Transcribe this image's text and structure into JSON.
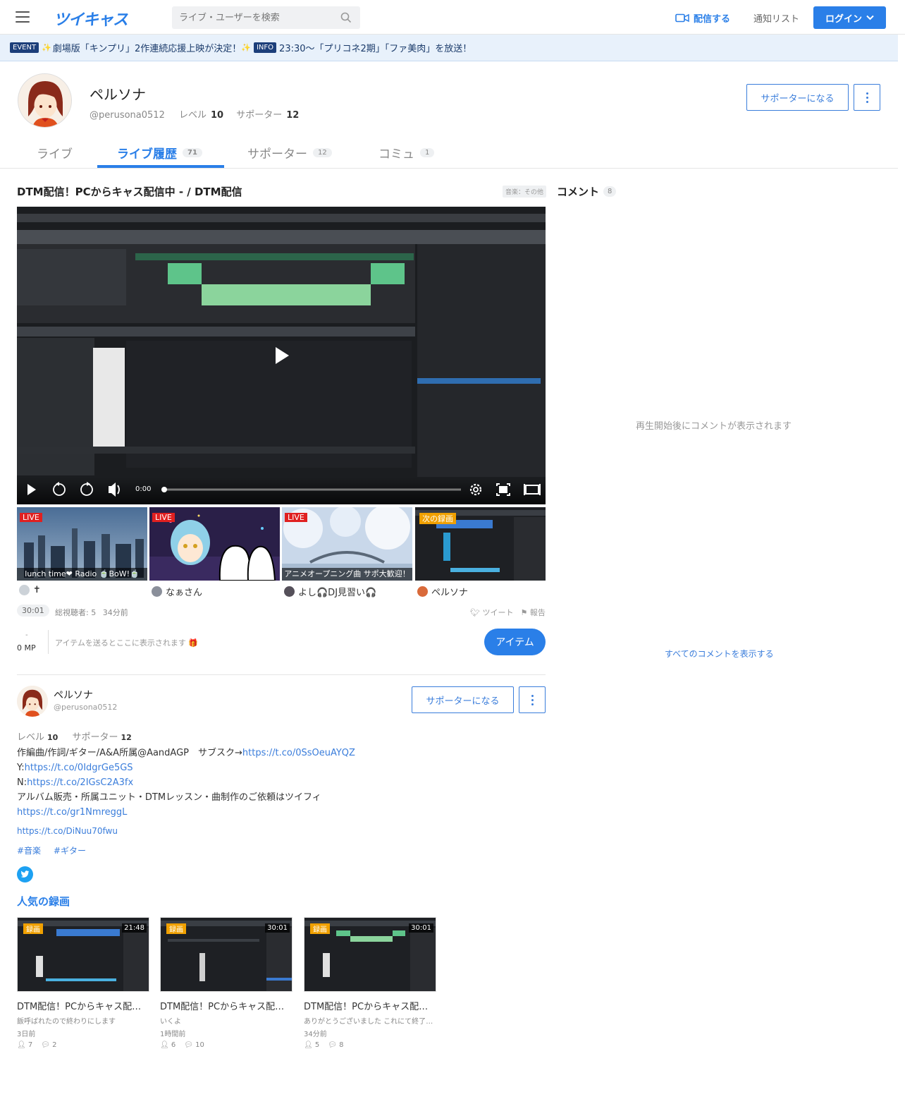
{
  "header": {
    "logo": "ツイキャス",
    "search_placeholder": "ライブ・ユーザーを検索",
    "broadcast": "配信する",
    "notices": "通知リスト",
    "login": "ログイン"
  },
  "ticker": {
    "event_tag": "EVENT",
    "event_text": "劇場版「キンプリ」2作連続応援上映が決定！",
    "info_tag": "INFO",
    "info_text": "23:30〜「プリコネ2期」「ファ美肉」を放送！"
  },
  "profile": {
    "name": "ペルソナ",
    "handle": "@perusona0512",
    "level_label": "レベル",
    "level": "10",
    "supporter_label": "サポーター",
    "supporters": "12",
    "become_supporter": "サポーターになる"
  },
  "tabs": [
    {
      "label": "ライブ",
      "count": ""
    },
    {
      "label": "ライブ履歴",
      "count": "71"
    },
    {
      "label": "サポーター",
      "count": "12"
    },
    {
      "label": "コミュ",
      "count": "1"
    }
  ],
  "movie": {
    "title": "DTM配信！PCからキャス配信中 - / DTM配信",
    "category": "音楽：その他",
    "time": "0:00",
    "duration": "30:01",
    "viewers": "総視聴者: 5",
    "ago": "34分前",
    "tweet": "ツイート",
    "report": "報告",
    "mp_value": "-",
    "mp": "0 MP",
    "item_hint": "アイテムを送るとここに表示されます 🎁",
    "item_button": "アイテム"
  },
  "related": [
    {
      "tag": "LIVE",
      "caption": "lunch time❤ Radio 🍵BoW!🍵",
      "user": "✝"
    },
    {
      "tag": "LIVE",
      "caption": "",
      "user": "なぁさん"
    },
    {
      "tag": "LIVE",
      "caption": "アニメオープニング曲 サポ大歓迎！",
      "user": "よし🎧DJ見習い🎧"
    },
    {
      "tag": "次の録画",
      "caption": "",
      "user": "ペルソナ"
    }
  ],
  "user_card": {
    "name": "ペルソナ",
    "handle": "@perusona0512",
    "level_label": "レベル",
    "level": "10",
    "supporter_label": "サポーター",
    "supporters": "12",
    "become_supporter": "サポーターになる",
    "bio_line1": "作編曲/作詞/ギター/A&A所属@AandAGP　サブスク→",
    "bio_link1": "https://t.co/0SsOeuAYQZ",
    "bio_line2_prefix": "Y:",
    "bio_link2": "https://t.co/0IdgrGe5GS",
    "bio_line3_prefix": "N:",
    "bio_link3": "https://t.co/2IGsC2A3fx",
    "bio_line4": "アルバム販売・所属ユニット・DTMレッスン・曲制作のご依頼はツイフィ",
    "bio_link4": "https://t.co/gr1NmreggL",
    "link": "https://t.co/DiNuu70fwu",
    "hashtags": [
      "#音楽",
      "#ギター"
    ]
  },
  "popular": {
    "title": "人気の録画",
    "items": [
      {
        "tag": "録画",
        "duration": "21:48",
        "title": "DTM配信！PCからキャス配信中 - / DTM配信",
        "sub": "飯呼ばれたので終わりにします",
        "when": "3日前",
        "viewers": "7",
        "comments": "2"
      },
      {
        "tag": "録画",
        "duration": "30:01",
        "title": "DTM配信！PCからキャス配信中 - / DTM配信",
        "sub": "いくよ",
        "when": "1時間前",
        "viewers": "6",
        "comments": "10"
      },
      {
        "tag": "録画",
        "duration": "30:01",
        "title": "DTM配信！PCからキャス配信中 - / DTM配信",
        "sub": "ありがとうございました これにて終了です",
        "when": "34分前",
        "viewers": "5",
        "comments": "8"
      }
    ]
  },
  "comments": {
    "title": "コメント",
    "count": "8",
    "empty": "再生開始後にコメントが表示されます",
    "show_all": "すべてのコメントを表示する"
  }
}
